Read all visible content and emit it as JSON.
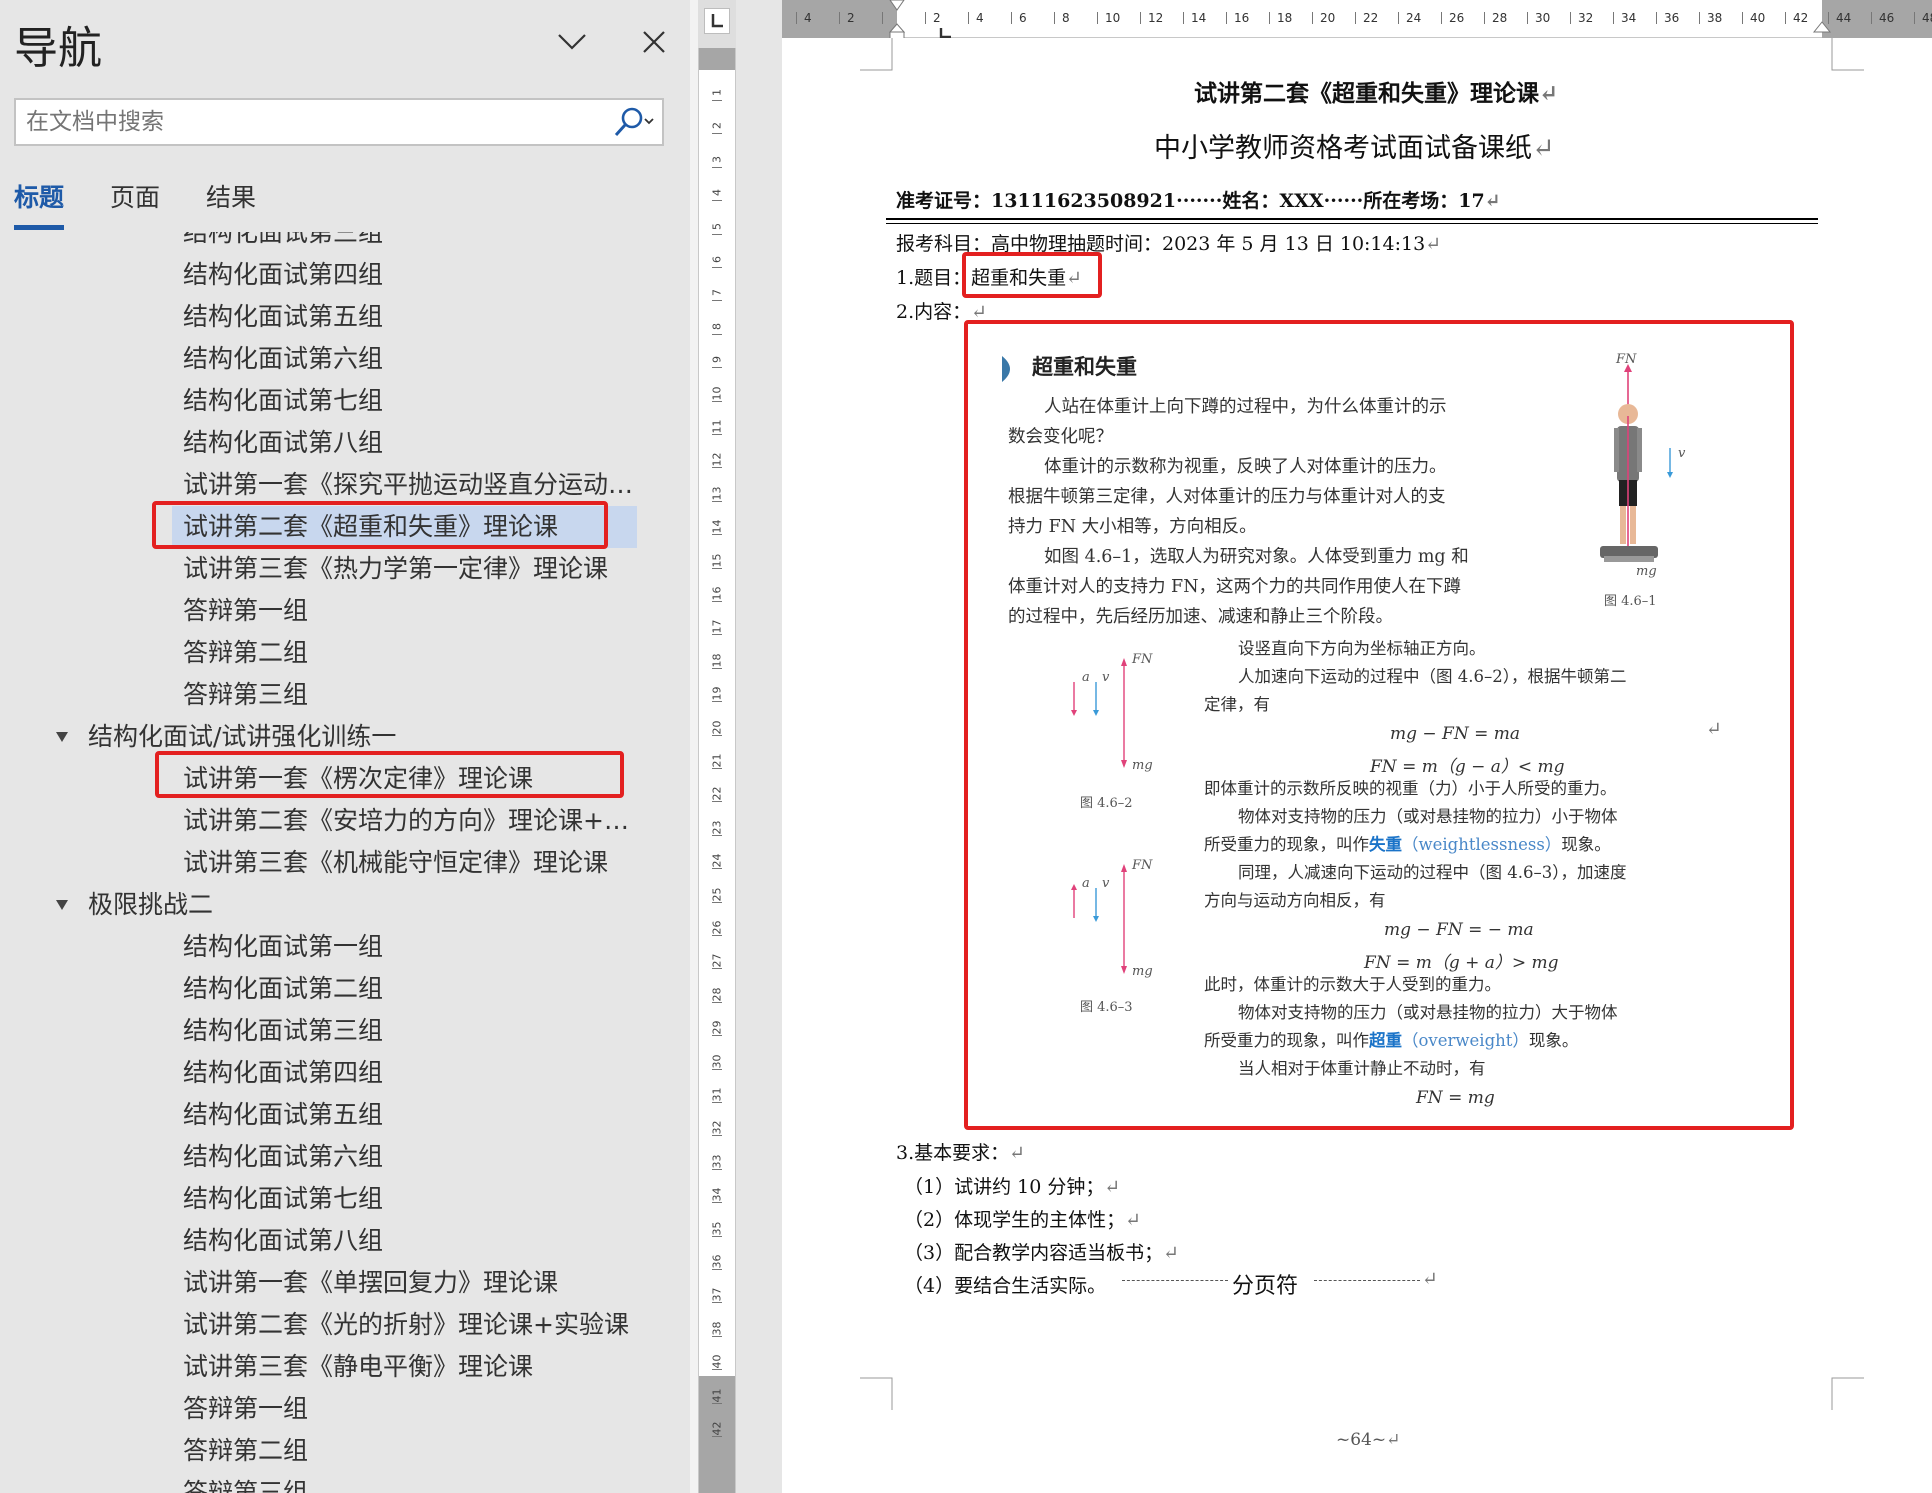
{
  "nav": {
    "title": "导航",
    "search_placeholder": "在文档中搜索",
    "tabs": [
      {
        "label": "标题",
        "active": true
      },
      {
        "label": "页面",
        "active": false
      },
      {
        "label": "结果",
        "active": false
      }
    ],
    "tree": [
      {
        "level": 2,
        "label": "结构化面试第三组"
      },
      {
        "level": 2,
        "label": "结构化面试第四组"
      },
      {
        "level": 2,
        "label": "结构化面试第五组"
      },
      {
        "level": 2,
        "label": "结构化面试第六组"
      },
      {
        "level": 2,
        "label": "结构化面试第七组"
      },
      {
        "level": 2,
        "label": "结构化面试第八组"
      },
      {
        "level": 2,
        "label": "试讲第一套《探究平抛运动竖直分运动的..."
      },
      {
        "level": 2,
        "label": "试讲第二套《超重和失重》理论课",
        "selected": true
      },
      {
        "level": 2,
        "label": "试讲第三套《热力学第一定律》理论课"
      },
      {
        "level": 2,
        "label": "答辩第一组"
      },
      {
        "level": 2,
        "label": "答辩第二组"
      },
      {
        "level": 2,
        "label": "答辩第三组"
      },
      {
        "level": 1,
        "label": "结构化面试/试讲强化训练一"
      },
      {
        "level": 2,
        "label": "试讲第一套《楞次定律》理论课"
      },
      {
        "level": 2,
        "label": "试讲第二套《安培力的方向》理论课+实..."
      },
      {
        "level": 2,
        "label": "试讲第三套《机械能守恒定律》理论课"
      },
      {
        "level": 1,
        "label": "极限挑战二"
      },
      {
        "level": 2,
        "label": "结构化面试第一组"
      },
      {
        "level": 2,
        "label": "结构化面试第二组"
      },
      {
        "level": 2,
        "label": "结构化面试第三组"
      },
      {
        "level": 2,
        "label": "结构化面试第四组"
      },
      {
        "level": 2,
        "label": "结构化面试第五组"
      },
      {
        "level": 2,
        "label": "结构化面试第六组"
      },
      {
        "level": 2,
        "label": "结构化面试第七组"
      },
      {
        "level": 2,
        "label": "结构化面试第八组"
      },
      {
        "level": 2,
        "label": "试讲第一套《单摆回复力》理论课"
      },
      {
        "level": 2,
        "label": "试讲第二套《光的折射》理论课+实验课"
      },
      {
        "level": 2,
        "label": "试讲第三套《静电平衡》理论课"
      },
      {
        "level": 2,
        "label": "答辩第一组"
      },
      {
        "level": 2,
        "label": "答辩第二组"
      },
      {
        "level": 2,
        "label": "答辩第三组"
      }
    ]
  },
  "hruler": {
    "labels": [
      "4",
      "2",
      "",
      "2",
      "4",
      "6",
      "8",
      "10",
      "12",
      "14",
      "16",
      "18",
      "20",
      "22",
      "24",
      "26",
      "28",
      "30",
      "32",
      "34",
      "36",
      "38",
      "40",
      "42",
      "44",
      "46",
      "48"
    ]
  },
  "vruler": {
    "labels": [
      "1",
      "2",
      "3",
      "4",
      "5",
      "6",
      "7",
      "8",
      "9",
      "10",
      "11",
      "12",
      "13",
      "14",
      "15",
      "16",
      "17",
      "18",
      "19",
      "20",
      "21",
      "22",
      "23",
      "24",
      "25",
      "26",
      "27",
      "28",
      "29",
      "30",
      "31",
      "32",
      "33",
      "34",
      "35",
      "36",
      "37",
      "38",
      "40",
      "41",
      "42"
    ]
  },
  "doc": {
    "heading1": "试讲第二套《超重和失重》理论课",
    "heading2": "中小学教师资格考试面试备课纸",
    "info_line": "准考证号：13111623508921·······姓名：XXX······所在考场：17",
    "subject_line": "报考科目：高中物理抽题时间：2023 年 5 月 13 日 10:14:13",
    "topic_label": "1.题目：",
    "topic_value": "超重和失重",
    "content_label": "2.内容：",
    "inner": {
      "title": "超重和失重",
      "p1a": "人站在体重计上向下蹲的过程中，为什么体重计的示",
      "p1b": "数会变化呢？",
      "p2a": "体重计的示数称为视重，反映了人对体重计的压力。",
      "p2b": "根据牛顿第三定律，人对体重计的压力与体重计对人的支",
      "p2c": "持力 FN 大小相等，方向相反。",
      "p3a": "如图 4.6–1，选取人为研究对象。人体受到重力 mg 和",
      "p3b": "体重计对人的支持力 FN，这两个力的共同作用使人在下蹲",
      "p3c": "的过程中，先后经历加速、减速和静止三个阶段。",
      "fig1": "图 4.6–1",
      "p4": "设竖直向下方向为坐标轴正方向。",
      "p5a": "人加速向下运动的过程中（图 4.6–2），根据牛顿第二",
      "p5b": "定律，有",
      "eq1": "mg − FN = ma",
      "eq2": "FN = m（g − a）< mg",
      "p6": "即体重计的示数所反映的视重（力）小于人所受的重力。",
      "p7a": "物体对支持物的压力（或对悬挂物的拉力）小于物体",
      "p7b_pre": "所受重力的现象，叫作",
      "p7b_term": "失重",
      "p7b_en": "（weightlessness）",
      "p7b_post": "现象。",
      "fig2": "图 4.6–2",
      "p8a": "同理，人减速向下运动的过程中（图 4.6–3），加速度",
      "p8b": "方向与运动方向相反，有",
      "eq3": "mg − FN = − ma",
      "eq4": "FN = m（g + a）> mg",
      "p9": "此时，体重计的示数大于人受到的重力。",
      "p10a": "物体对支持物的压力（或对悬挂物的拉力）大于物体",
      "p10b_pre": "所受重力的现象，叫作",
      "p10b_term": "超重",
      "p10b_en": "（overweight）",
      "p10b_post": "现象。",
      "fig3": "图 4.6–3",
      "p11": "当人相对于体重计静止不动时，有",
      "eq5": "FN = mg",
      "lbl_fn": "FN",
      "lbl_mg": "mg",
      "lbl_v": "v",
      "lbl_a": "a"
    },
    "req_title": "3.基本要求：",
    "req1": "（1）试讲约 10 分钟；",
    "req2": "（2）体现学生的主体性；",
    "req3": "（3）配合教学内容适当板书；",
    "req4": "（4）要结合生活实际。",
    "page_break": "分页符",
    "page_number": "~64~"
  }
}
